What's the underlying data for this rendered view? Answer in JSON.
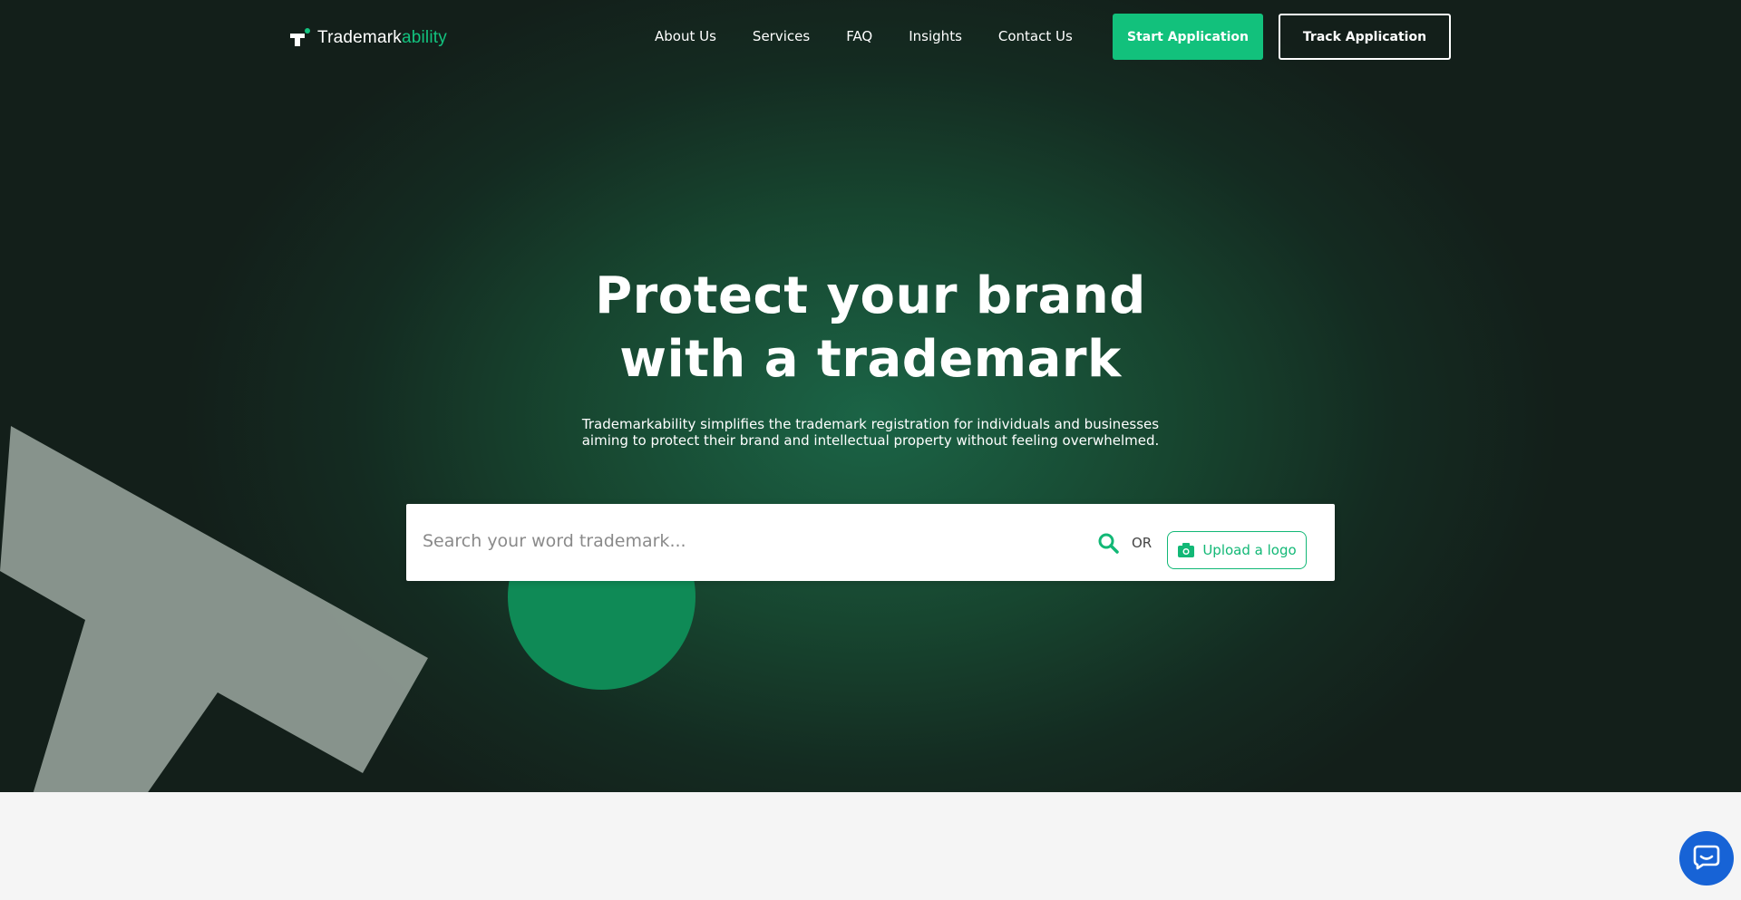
{
  "brand": {
    "name_main": "Trademark",
    "name_accent": "ability",
    "accent_color": "#13c37f"
  },
  "nav": {
    "items": [
      {
        "label": "About Us"
      },
      {
        "label": "Services"
      },
      {
        "label": "FAQ"
      },
      {
        "label": "Insights"
      },
      {
        "label": "Contact Us"
      }
    ],
    "start_label": "Start Application",
    "track_label": "Track Application"
  },
  "hero": {
    "title_line1": "Protect your brand",
    "title_line2": "with a trademark",
    "subtitle_line1": "Trademarkability simplifies the trademark registration for individuals and businesses",
    "subtitle_line2": "aiming to protect their brand and intellectual property without feeling overwhelmed."
  },
  "search": {
    "placeholder": "Search your word trademark...",
    "value": "",
    "or_label": "OR",
    "upload_label": "Upload a logo",
    "search_icon": "search-icon",
    "upload_icon": "camera-icon"
  },
  "chat": {
    "icon": "chat-bubble-icon",
    "color": "#1763d6"
  }
}
